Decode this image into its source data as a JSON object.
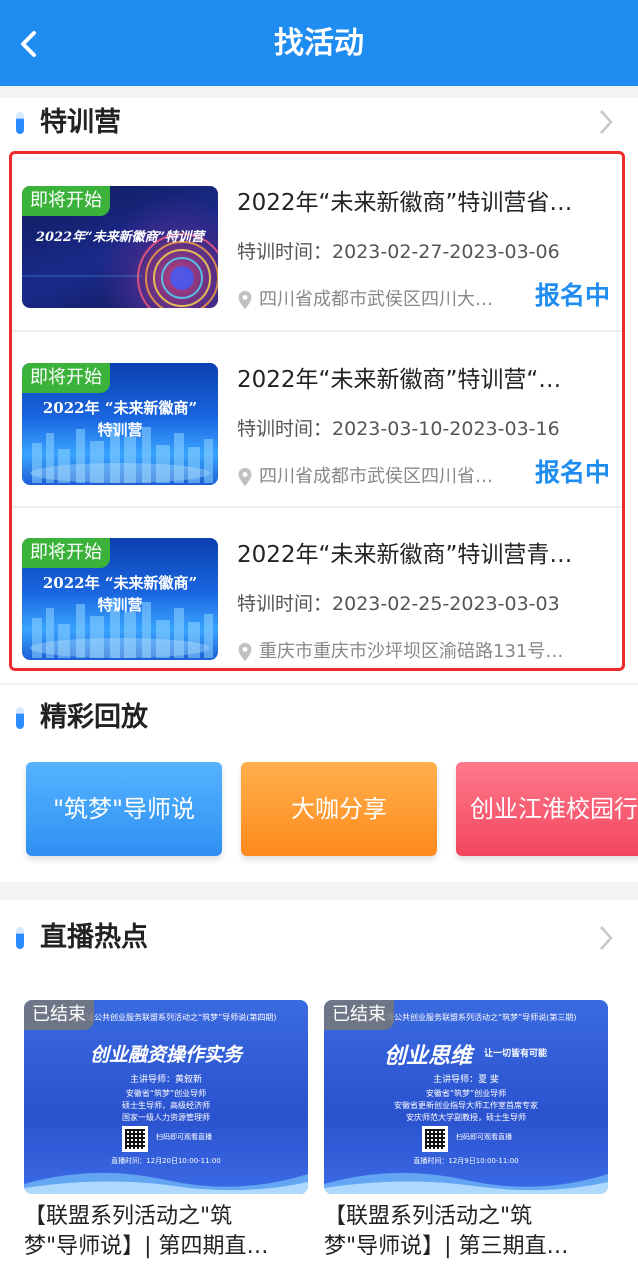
{
  "header": {
    "title": "找活动"
  },
  "training": {
    "section_title": "特训营",
    "time_label": "特训时间：",
    "items": [
      {
        "badge": "即将开始",
        "thumb_caption": "2022年“未来新徽商”特训营",
        "title": "2022年“未来新徽商”特训营省…",
        "time": "2023-02-27-2023-03-06",
        "location": "四川省成都市武侯区四川大…",
        "status": "报名中"
      },
      {
        "badge": "即将开始",
        "thumb_caption_1": "2022年 “未来新徽商”",
        "thumb_caption_2": "特训营",
        "title": "2022年“未来新徽商”特训营“…",
        "time": "2023-03-10-2023-03-16",
        "location": "四川省成都市武侯区四川省…",
        "status": "报名中"
      },
      {
        "badge": "即将开始",
        "thumb_caption_1": "2022年 “未来新徽商”",
        "thumb_caption_2": "特训营",
        "title": "2022年“未来新徽商”特训营青…",
        "time": "2023-02-25-2023-03-03",
        "location": "重庆市重庆市沙坪坝区渝碚路131号…",
        "status": ""
      }
    ]
  },
  "replay": {
    "section_title": "精彩回放",
    "buttons": [
      "\"筑梦\"导师说",
      "大咖分享",
      "创业江淮校园行"
    ]
  },
  "live": {
    "section_title": "直播热点",
    "items": [
      {
        "badge": "已结束",
        "poster_top": "长三角区域公共创业服务联盟系列活动之“筑梦”导师说(第四期)",
        "poster_title": "创业融资操作实务",
        "mentor": "主讲导师：黄叙新",
        "desc_1": "安徽省“筑梦”创业导师",
        "desc_2": "硕士生导师，高级经济师",
        "desc_3": "国家一级人力资源管理师",
        "qr_label": "扫码即可观看直播",
        "time_line": "直播时间：12月20日10:00-11:00",
        "title_line1": "【联盟系列活动之\"筑",
        "title_line2": "梦\"导师说】| 第四期直…"
      },
      {
        "badge": "已结束",
        "poster_top": "长三角区域公共创业服务联盟系列活动之“筑梦”导师说(第三期)",
        "poster_title": "创业思维",
        "poster_sub": "让一切皆有可能",
        "mentor": "主讲导师：夏 斐",
        "desc_1": "安徽省“筑梦”创业导师",
        "desc_2": "安徽省更新创业指导大师工作室首席专家",
        "desc_3": "安庆师范大学副教授，硕士生导师",
        "qr_label": "扫码即可观看直播",
        "time_line": "直播时间：12月9日10:00-11:00",
        "title_line1": "【联盟系列活动之\"筑",
        "title_line2": "梦\"导师说】| 第三期直…"
      }
    ]
  },
  "colors": {
    "primary": "#1e8cf0",
    "badge_green": "#3bb33b",
    "highlight_red": "#ee2a2a"
  }
}
